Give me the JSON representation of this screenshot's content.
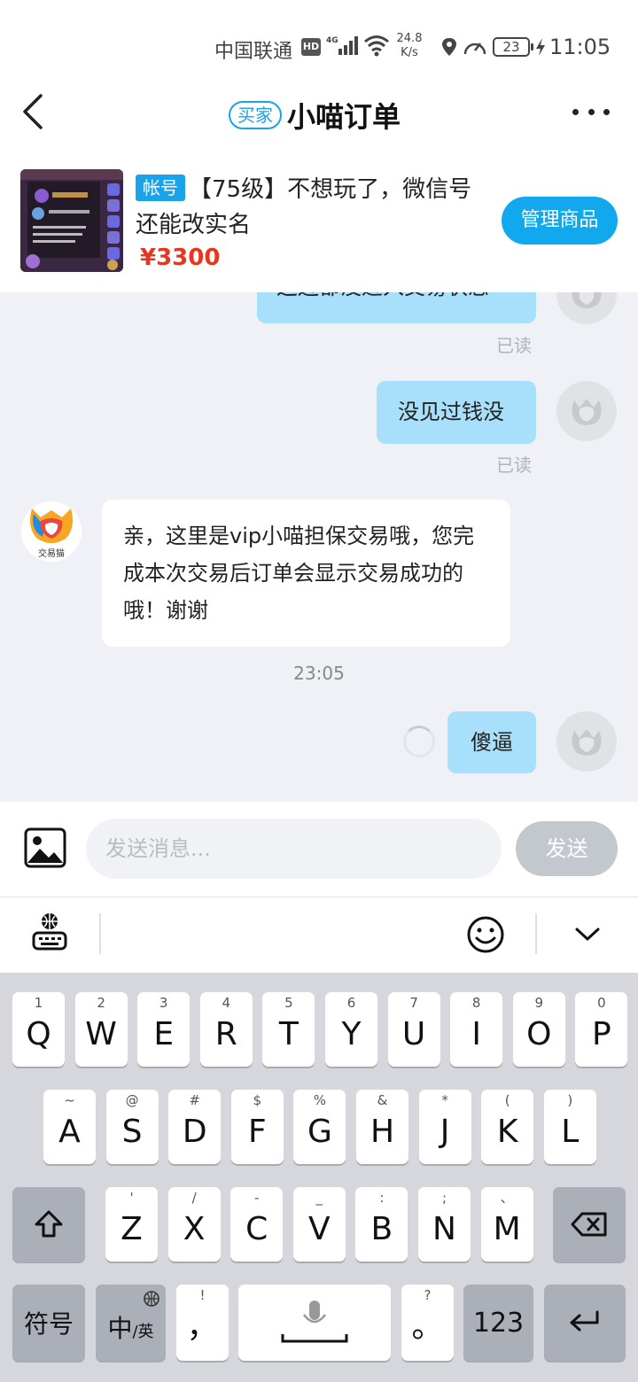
{
  "status_bar": {
    "carrier": "中国联通",
    "hd": "HD",
    "network": "4G",
    "speed_value": "24.8",
    "speed_unit": "K/s",
    "battery": "23",
    "time": "11:05"
  },
  "header": {
    "role_badge": "买家",
    "title": "小喵订单",
    "back_icon": "chevron-left-icon",
    "more_icon": "more-dots-icon"
  },
  "product": {
    "tag": "帐号",
    "title": "【75级】不想玩了，微信号还能改实名",
    "price": "¥3300",
    "manage_label": "管理商品"
  },
  "messages": {
    "m1_text": "这边都没进入交易状态",
    "m1_status": "已读",
    "m2_text": "没见过钱没",
    "m2_status": "已读",
    "m3_text": "亲，这里是vip小喵担保交易哦，您完成本次交易后订单会显示交易成功的哦！谢谢",
    "m3_avatar_label": "交易猫",
    "time_label": "23:05",
    "m4_text": "傻逼"
  },
  "input": {
    "placeholder": "发送消息...",
    "send_label": "发送"
  },
  "keyboard": {
    "row1": [
      {
        "hint": "1",
        "key": "Q"
      },
      {
        "hint": "2",
        "key": "W"
      },
      {
        "hint": "3",
        "key": "E"
      },
      {
        "hint": "4",
        "key": "R"
      },
      {
        "hint": "5",
        "key": "T"
      },
      {
        "hint": "6",
        "key": "Y"
      },
      {
        "hint": "7",
        "key": "U"
      },
      {
        "hint": "8",
        "key": "I"
      },
      {
        "hint": "9",
        "key": "O"
      },
      {
        "hint": "0",
        "key": "P"
      }
    ],
    "row2": [
      {
        "hint": "~",
        "key": "A"
      },
      {
        "hint": "@",
        "key": "S"
      },
      {
        "hint": "#",
        "key": "D"
      },
      {
        "hint": "$",
        "key": "F"
      },
      {
        "hint": "%",
        "key": "G"
      },
      {
        "hint": "&",
        "key": "H"
      },
      {
        "hint": "*",
        "key": "J"
      },
      {
        "hint": "(",
        "key": "K"
      },
      {
        "hint": ")",
        "key": "L"
      }
    ],
    "row3": [
      {
        "hint": "'",
        "key": "Z"
      },
      {
        "hint": "/",
        "key": "X"
      },
      {
        "hint": "-",
        "key": "C"
      },
      {
        "hint": "_",
        "key": "V"
      },
      {
        "hint": ":",
        "key": "B"
      },
      {
        "hint": ";",
        "key": "N"
      },
      {
        "hint": "、",
        "key": "M"
      }
    ],
    "symbols_label": "符号",
    "lang_main": "中",
    "lang_sub": "/英",
    "comma_hint": "!",
    "comma_key": "，",
    "period_hint": "?",
    "period_key": "。",
    "num_label": "123"
  },
  "colors": {
    "accent": "#12a8ee",
    "bubble_out": "#a8e0fb",
    "price": "#e5371f",
    "chat_bg": "#eff1f6"
  }
}
